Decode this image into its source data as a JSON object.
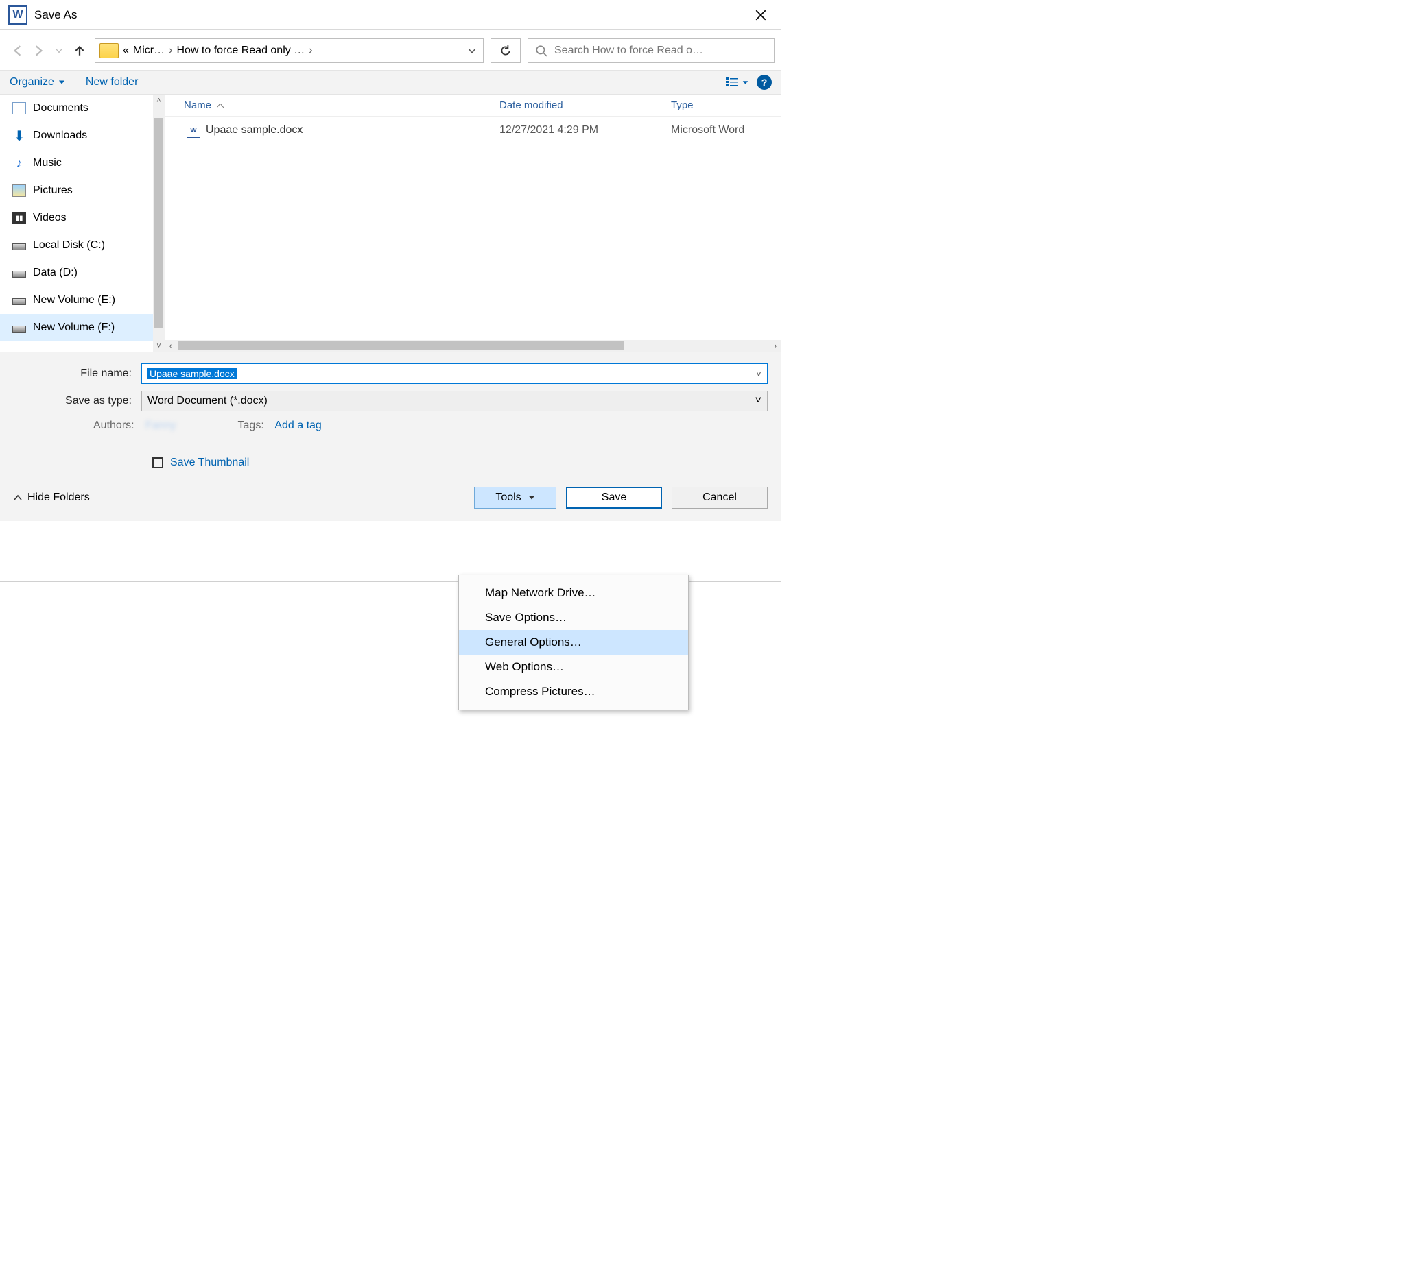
{
  "title": "Save As",
  "breadcrumb": {
    "first": "Micr…",
    "second": "How to force Read only …",
    "prefix": "«"
  },
  "search_placeholder": "Search How to force Read o…",
  "toolbar": {
    "organize": "Organize",
    "newfolder": "New folder",
    "help": "?"
  },
  "tree": [
    {
      "label": "Documents",
      "icon": "documents"
    },
    {
      "label": "Downloads",
      "icon": "downloads"
    },
    {
      "label": "Music",
      "icon": "music"
    },
    {
      "label": "Pictures",
      "icon": "pictures"
    },
    {
      "label": "Videos",
      "icon": "videos"
    },
    {
      "label": "Local Disk (C:)",
      "icon": "disk"
    },
    {
      "label": "Data (D:)",
      "icon": "disk"
    },
    {
      "label": "New Volume (E:)",
      "icon": "disk"
    },
    {
      "label": "New Volume (F:)",
      "icon": "disk",
      "selected": true
    }
  ],
  "columns": {
    "name": "Name",
    "date": "Date modified",
    "type": "Type"
  },
  "rows": [
    {
      "name": "Upaae sample.docx",
      "date": "12/27/2021 4:29 PM",
      "type": "Microsoft Word"
    }
  ],
  "form": {
    "filename_label": "File name:",
    "filename_value": "Upaae sample.docx",
    "saveastype_label": "Save as type:",
    "saveastype_value": "Word Document (*.docx)",
    "authors_label": "Authors:",
    "authors_value": "Fanny",
    "tags_label": "Tags:",
    "tags_value": "Add a tag",
    "save_thumbnail": "Save Thumbnail"
  },
  "bottom": {
    "hide_folders": "Hide Folders",
    "tools": "Tools",
    "save": "Save",
    "cancel": "Cancel"
  },
  "tools_menu": [
    "Map Network Drive…",
    "Save Options…",
    "General Options…",
    "Web Options…",
    "Compress Pictures…"
  ],
  "tools_menu_highlight_index": 2
}
